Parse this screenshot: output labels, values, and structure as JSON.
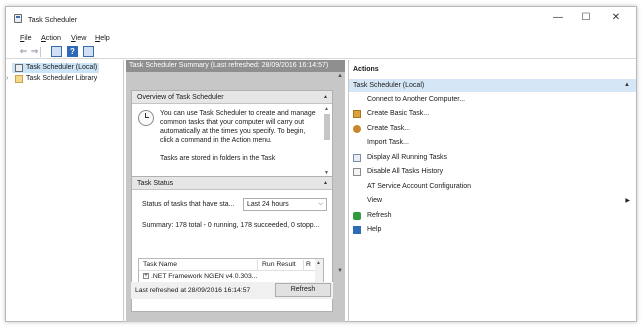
{
  "window": {
    "title": "Task Scheduler",
    "controls": {
      "minimize": "—",
      "maximize": "☐",
      "close": "✕"
    }
  },
  "menu": [
    {
      "accel": "F",
      "rest": "ile"
    },
    {
      "accel": "A",
      "rest": "ction"
    },
    {
      "accel": "V",
      "rest": "iew"
    },
    {
      "accel": "H",
      "rest": "elp"
    }
  ],
  "toolbar": {
    "back_glyph": "⇐",
    "forward_glyph": "⇒",
    "help_glyph": "?",
    "icons": [
      "back-arrow-icon",
      "forward-arrow-icon",
      "console-tree-icon",
      "help-icon",
      "properties-icon"
    ]
  },
  "tree": {
    "items": [
      {
        "label": "Task Scheduler (Local)",
        "selected": true,
        "icon": "task-scheduler-icon"
      },
      {
        "label": "Task Scheduler Library",
        "selected": false,
        "icon": "folder-icon",
        "expander": "›"
      }
    ]
  },
  "center": {
    "summary_header": "Task Scheduler Summary (Last refreshed: 28/09/2016 16:14:57)",
    "overview": {
      "title": "Overview of Task Scheduler",
      "collapse_glyph": "▲",
      "scroll_up": "▲",
      "scroll_down": "▼",
      "text": "You can use Task Scheduler to create and manage common tasks that your computer will carry out automatically at the times you specify. To begin, click a command in the Action menu.",
      "text2": "Tasks are stored in folders in the Task"
    },
    "task_status": {
      "title": "Task Status",
      "collapse_glyph": "▲",
      "status_label": "Status of tasks that have sta...",
      "period_value": "Last 24 hours",
      "period_dropdown_glyph": "⌵",
      "summary": "Summary: 178 total - 0 running, 178 succeeded, 0 stopp...",
      "table": {
        "columns": [
          "Task Name",
          "Run Result",
          "R"
        ],
        "rows": [
          {
            "expand_glyph": "+",
            "name": ".NET Framework NGEN v4.0.303..."
          }
        ],
        "scroll_up": "▲",
        "scroll_down": "▼"
      }
    },
    "scroll_up": "▲",
    "scroll_down": "▼",
    "last_refreshed": "Last refreshed at 28/09/2016 16:14:57",
    "refresh_button": "Refresh"
  },
  "actions": {
    "title": "Actions",
    "group": "Task Scheduler (Local)",
    "group_collapse_glyph": "▲",
    "items": [
      {
        "label": "Connect to Another Computer...",
        "icon": ""
      },
      {
        "label": "Create Basic Task...",
        "icon": "create-basic-task-icon",
        "color": "#d9a23a"
      },
      {
        "label": "Create Task...",
        "icon": "create-task-icon",
        "color": "#c9872d"
      },
      {
        "label": "Import Task...",
        "icon": ""
      },
      {
        "label": "Display All Running Tasks",
        "icon": "running-tasks-icon",
        "color": "#7a8ea8"
      },
      {
        "label": "Disable All Tasks History",
        "icon": "history-icon",
        "color": "#8a8a8a"
      },
      {
        "label": "AT Service Account Configuration",
        "icon": ""
      },
      {
        "label": "View",
        "icon": "",
        "submenu_glyph": "▶"
      },
      {
        "label": "Refresh",
        "icon": "refresh-icon",
        "color": "#2e9a3f"
      },
      {
        "label": "Help",
        "icon": "help-icon",
        "color": "#2f6ab8"
      }
    ]
  },
  "colors": {
    "selection": "#cce4f7",
    "summary_header_bg": "#8f8f8f",
    "center_bg": "#c7c7c7",
    "actions_group_bg": "#d5e7f7"
  }
}
